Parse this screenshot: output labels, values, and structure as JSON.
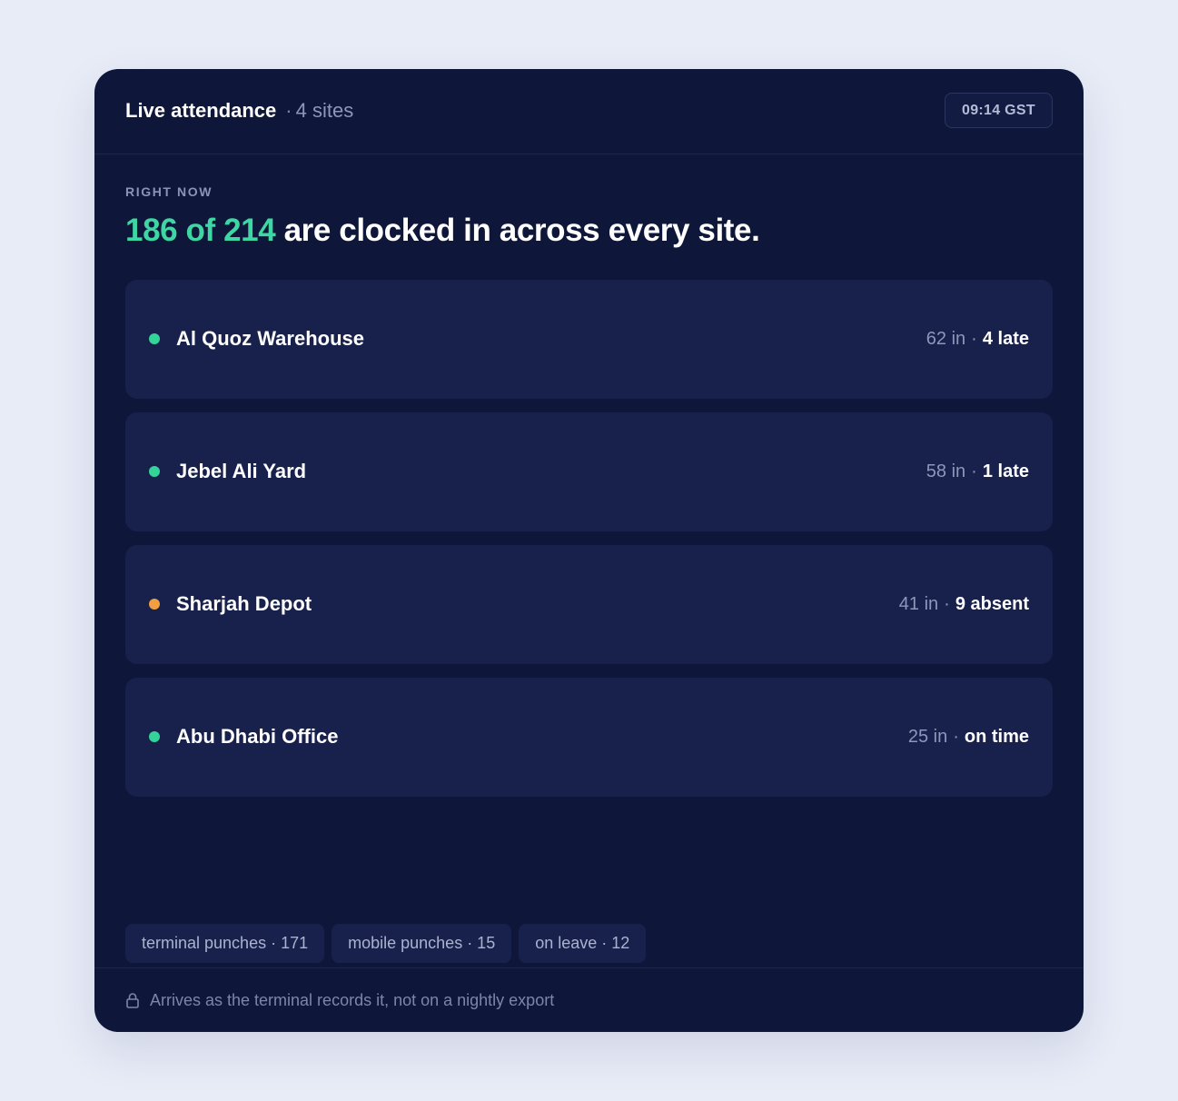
{
  "header": {
    "title": "Live attendance",
    "separator": "·",
    "sites_count": "4 sites",
    "time": "09:14 GST"
  },
  "summary": {
    "eyebrow": "RIGHT NOW",
    "headline_accent": "186 of 214",
    "headline_rest": "are clocked in across every site."
  },
  "sites": [
    {
      "name": "Al Quoz Warehouse",
      "in": "62 in",
      "status": "4 late",
      "dot_color": "#34d399"
    },
    {
      "name": "Jebel Ali Yard",
      "in": "58 in",
      "status": "1 late",
      "dot_color": "#34d399"
    },
    {
      "name": "Sharjah Depot",
      "in": "41 in",
      "status": "9 absent",
      "dot_color": "#f0a040"
    },
    {
      "name": "Abu Dhabi Office",
      "in": "25 in",
      "status": "on time",
      "dot_color": "#34d399"
    }
  ],
  "chips": [
    "terminal punches · 171",
    "mobile punches · 15",
    "on leave · 12"
  ],
  "footer": {
    "icon": "lock-icon",
    "text": "Arrives as the terminal records it, not on a nightly export"
  },
  "colors": {
    "accent": "#3ed6a3",
    "card_background": "#0e1739",
    "row_background": "#18214c",
    "page_background": "#e8ecf7"
  }
}
